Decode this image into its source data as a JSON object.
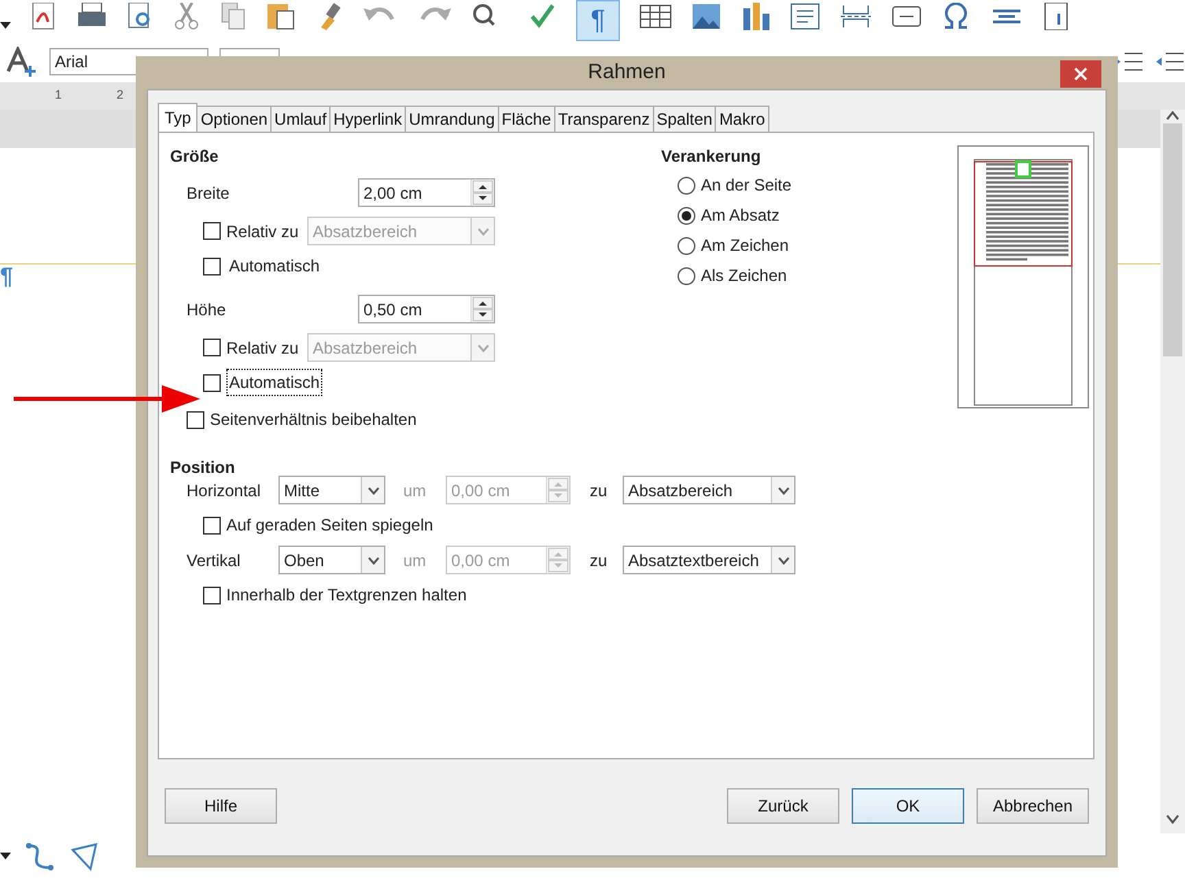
{
  "formatting_toolbar": {
    "font_name": "Arial"
  },
  "standard_toolbar": {
    "pilcrow": "¶",
    "pilcrow_active": true
  },
  "ruler": {
    "marks": [
      "1",
      "2"
    ]
  },
  "document": {
    "pilcrow": "¶"
  },
  "dialog": {
    "title": "Rahmen",
    "tabs": [
      {
        "label": "Typ",
        "selected": true
      },
      {
        "label": "Optionen",
        "selected": false
      },
      {
        "label": "Umlauf",
        "selected": false
      },
      {
        "label": "Hyperlink",
        "selected": false
      },
      {
        "label": "Umrandung",
        "selected": false
      },
      {
        "label": "Fläche",
        "selected": false
      },
      {
        "label": "Transparenz",
        "selected": false
      },
      {
        "label": "Spalten",
        "selected": false
      },
      {
        "label": "Makro",
        "selected": false
      }
    ],
    "size": {
      "heading": "Größe",
      "rows": [
        {
          "kind": "spin",
          "label": "Breite",
          "value": "2,00 cm"
        },
        {
          "kind": "check-select",
          "label": "Relativ zu",
          "checked": false,
          "value": "Absatzbereich",
          "disabled": true
        },
        {
          "kind": "check",
          "label": "Automatisch",
          "checked": false,
          "focused": false
        },
        {
          "kind": "spin",
          "label": "Höhe",
          "value": "0,50 cm"
        },
        {
          "kind": "check-select",
          "label": "Relativ zu",
          "checked": false,
          "value": "Absatzbereich",
          "disabled": true
        },
        {
          "kind": "check",
          "label": "Automatisch",
          "checked": false,
          "focused": true
        }
      ],
      "keep_ratio": {
        "label": "Seitenverhältnis beibehalten",
        "checked": false
      }
    },
    "anchor": {
      "heading": "Verankerung",
      "options": [
        {
          "label": "An der Seite",
          "selected": false
        },
        {
          "label": "Am Absatz",
          "selected": true
        },
        {
          "label": "Am Zeichen",
          "selected": false
        },
        {
          "label": "Als Zeichen",
          "selected": false
        }
      ]
    },
    "position": {
      "heading": "Position",
      "rows": [
        {
          "kind": "align",
          "label": "Horizontal",
          "value": "Mitte",
          "by_label": "um",
          "by_value": "0,00 cm",
          "by_disabled": true,
          "to_label": "zu",
          "to_value": "Absatzbereich"
        },
        {
          "kind": "check",
          "label": "Auf geraden Seiten spiegeln",
          "checked": false
        },
        {
          "kind": "align",
          "label": "Vertikal",
          "value": "Oben",
          "by_label": "um",
          "by_value": "0,00 cm",
          "by_disabled": true,
          "to_label": "zu",
          "to_value": "Absatztextbereich"
        },
        {
          "kind": "check",
          "label": "Innerhalb der Textgrenzen halten",
          "checked": false
        }
      ]
    },
    "buttons": [
      {
        "label": "Hilfe",
        "default": false
      },
      {
        "label": "Zurück",
        "default": false
      },
      {
        "label": "OK",
        "default": true
      },
      {
        "label": "Abbrechen",
        "default": false
      }
    ]
  }
}
